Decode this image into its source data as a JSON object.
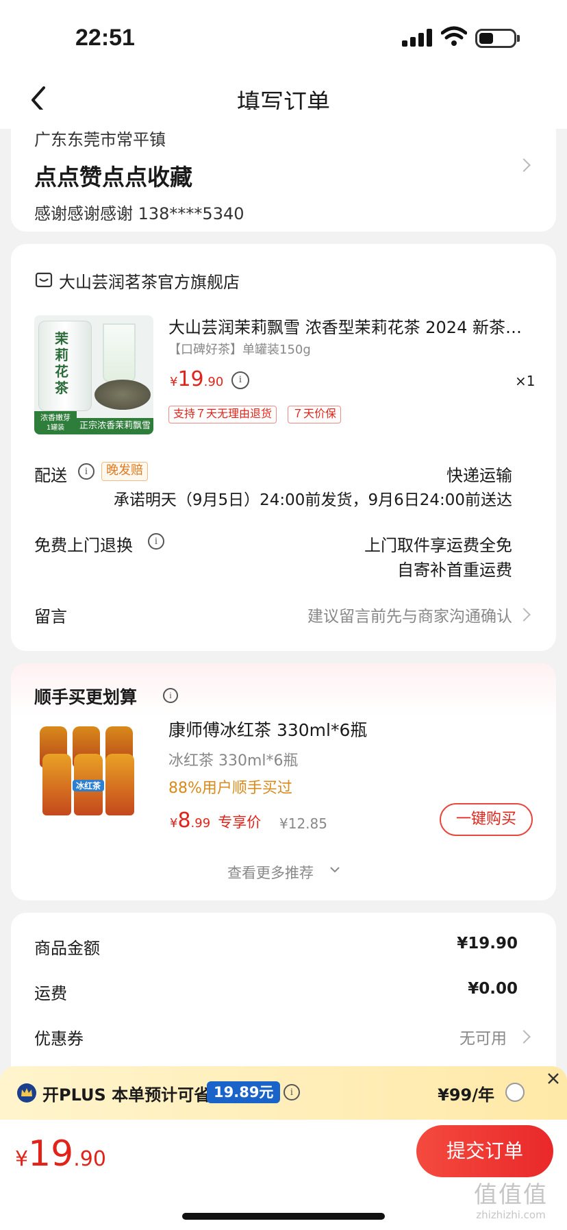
{
  "status_bar": {
    "time": "22:51"
  },
  "header": {
    "title": "填写订单"
  },
  "address": {
    "region": "广东东莞市常平镇",
    "detail": "点点赞点点收藏",
    "contact": "感谢感谢感谢  138****5340"
  },
  "store": {
    "name": "大山芸润茗茶官方旗舰店",
    "product": {
      "title": "大山芸润茉莉飘雪 浓香型茉莉花茶 2024 新茶…",
      "spec": "【口碑好茶】单罐装150g",
      "price_symbol": "¥",
      "price_int": "19",
      "price_dec": ".90",
      "qty": "×1",
      "tag1": "支持７天无理由退货",
      "tag2": "７天价保",
      "image_text": {
        "can_label": "茉莉花茶",
        "badge": "浓香嫩芽",
        "badge_sub": "1罐装",
        "caption": "正宗浓香茉莉飘雪"
      }
    },
    "delivery": {
      "label": "配送",
      "badge": "晚发赔",
      "method": "快递运输",
      "promise": "承诺明天（9月5日）24:00前发货，9月6日24:00前送达"
    },
    "return": {
      "label": "免费上门退换",
      "line1": "上门取件享运费全免",
      "line2": "自寄补首重运费"
    },
    "note": {
      "label": "留言",
      "placeholder": "建议留言前先与商家沟通确认"
    }
  },
  "recommend": {
    "title": "顺手买更划算",
    "product_title": "康师傅冰红茶 330ml*6瓶",
    "product_sub": "冰红茶 330ml*6瓶",
    "stat": "88%用户顺手买过",
    "price_symbol": "¥",
    "price_int": "8",
    "price_dec": ".99",
    "price_tag": "专享价",
    "orig_price": "¥12.85",
    "buy_label": "一键购买",
    "more_label": "查看更多推荐",
    "image_text": "冰红茶"
  },
  "summary": {
    "rows": [
      {
        "label": "商品金额",
        "value": "¥19.90"
      },
      {
        "label": "运费",
        "value": "¥0.00"
      },
      {
        "label": "优惠券",
        "value": "无可用"
      }
    ]
  },
  "plus": {
    "text": "开PLUS 本单预计可省",
    "save": "19.89元",
    "price": "¥99/年"
  },
  "footer": {
    "total_symbol": "¥",
    "total_int": "19",
    "total_dec": ".90",
    "submit_label": "提交订单",
    "watermark": "值值值",
    "watermark_url": "zhizhizhi.com"
  },
  "colors": {
    "accent_red": "#e2231a",
    "plus_blue": "#1a63c9",
    "bg": "#f2f2f2"
  }
}
